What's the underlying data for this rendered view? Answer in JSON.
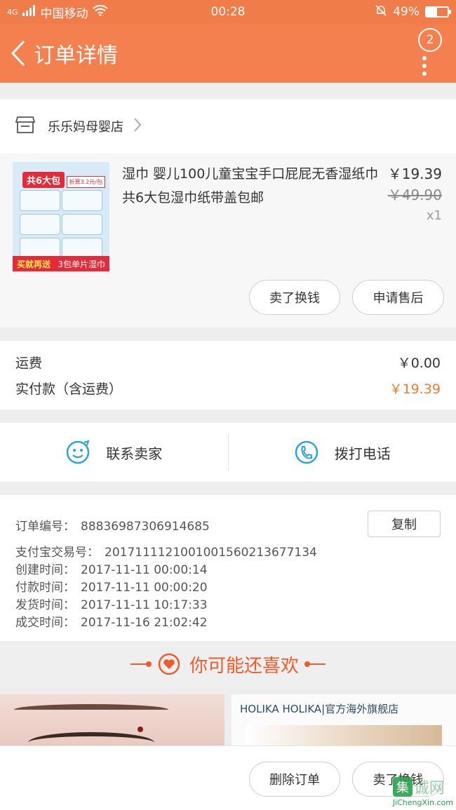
{
  "status_bar": {
    "network": "4G",
    "carrier": "中国移动",
    "time": "00:28",
    "battery": "49%",
    "battery_level": 0.49
  },
  "header": {
    "title": "订单详情",
    "badge_count": "2"
  },
  "store": {
    "name": "乐乐妈母婴店"
  },
  "product": {
    "name": "湿巾 婴儿100儿童宝宝手口屁屁无香湿纸巾共6大包湿巾纸带盖包邮",
    "price": "￥19.39",
    "original_price": "￥49.90",
    "quantity": "x1",
    "image_tag": "共6大包",
    "image_promo_left": "买就再送",
    "image_promo_right": "3包单片湿巾",
    "image_price_flag": "折算3.2元/包"
  },
  "actions": {
    "buy_again": "卖了换钱",
    "after_sales": "申请售后"
  },
  "totals": {
    "shipping_label": "运费",
    "shipping_value": "￥0.00",
    "paid_label": "实付款（含运费）",
    "paid_value": "￥19.39"
  },
  "contact": {
    "seller_label": "联系卖家",
    "phone_label": "拨打电话"
  },
  "order": {
    "number_label": "订单编号：",
    "number_value": "88836987306914685",
    "copy_label": "复制",
    "alipay_label": "支付宝交易号：",
    "alipay_value": "2017111121001001560213677134",
    "created_label": "创建时间：",
    "created_value": "2017-11-11 00:00:14",
    "paid_label": "付款时间：",
    "paid_value": "2017-11-11 00:00:20",
    "shipped_label": "发货时间：",
    "shipped_value": "2017-11-11 10:17:33",
    "completed_label": "成交时间：",
    "completed_value": "2017-11-16 21:02:42"
  },
  "recommend": {
    "title": "你可能还喜欢",
    "card2_brand": "HOLIKA HOLIKA|官方海外旗舰店"
  },
  "bottom": {
    "delete_label": "删除订单",
    "buy_again_label": "卖了换钱"
  },
  "watermark": {
    "logo_char": "集",
    "logo_text": "诚网",
    "site": "JiChengXin.com"
  },
  "colors": {
    "brand_orange": "#f5804f",
    "price_accent": "#f07c30",
    "icon_blue": "#2ea1e6"
  }
}
